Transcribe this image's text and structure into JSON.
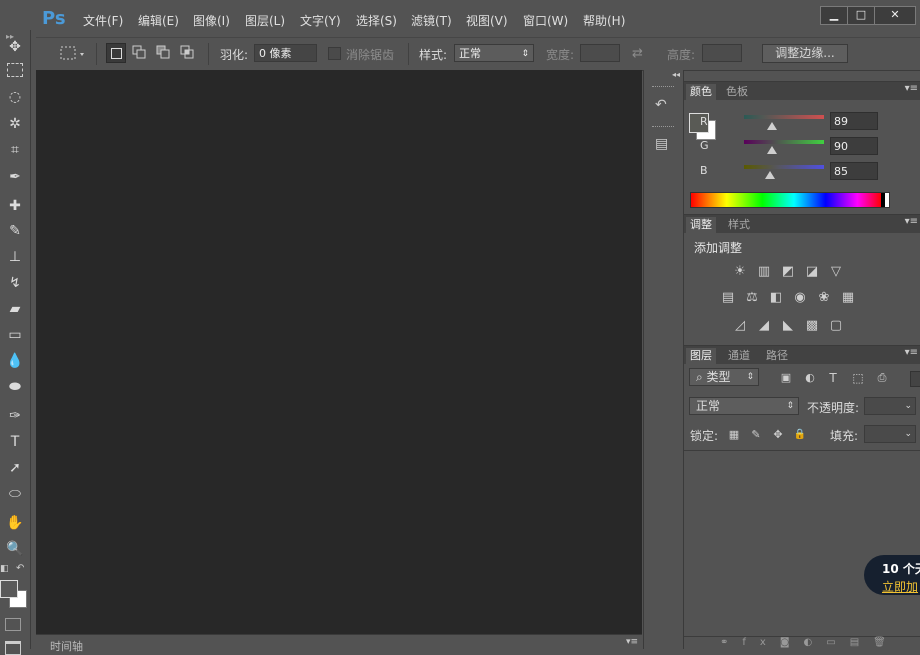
{
  "app": {
    "logo": "Ps"
  },
  "menu": [
    "文件(F)",
    "编辑(E)",
    "图像(I)",
    "图层(L)",
    "文字(Y)",
    "选择(S)",
    "滤镜(T)",
    "视图(V)",
    "窗口(W)",
    "帮助(H)"
  ],
  "window_controls": {
    "minimize": "▁",
    "maximize": "□",
    "close": "✕"
  },
  "options": {
    "feather_label": "羽化:",
    "feather_value": "0 像素",
    "antialias_label": "消除锯齿",
    "style_label": "样式:",
    "style_value": "正常",
    "width_label": "宽度:",
    "height_label": "高度:",
    "refine_edge": "调整边缘..."
  },
  "timeline": {
    "tab": "时间轴"
  },
  "color_panel": {
    "tabs": [
      "颜色",
      "色板"
    ],
    "channels": [
      {
        "label": "R",
        "value": "89",
        "level": 0.35
      },
      {
        "label": "G",
        "value": "90",
        "level": 0.35
      },
      {
        "label": "B",
        "value": "85",
        "level": 0.33
      }
    ],
    "colors": {
      "r_track": "#cc4a4a",
      "g_track": "#3ec43e",
      "b_track": "#4a4ad8"
    }
  },
  "adjust_panel": {
    "tabs": [
      "调整",
      "样式"
    ],
    "heading": "添加调整",
    "icons_row1": [
      "☀",
      "▥",
      "◩",
      "◪",
      "▽"
    ],
    "icons_row2": [
      "▤",
      "⚖",
      "◧",
      "◉",
      "❀",
      "▦"
    ],
    "icons_row3": [
      "◿",
      "◢",
      "◣",
      "▩",
      "▢"
    ]
  },
  "layers_panel": {
    "tabs": [
      "图层",
      "通道",
      "路径"
    ],
    "filter_kind": "⌕ 类型",
    "filter_icons": [
      "▣",
      "◐",
      "T",
      "⬚",
      "⎙"
    ],
    "blend_mode": "正常",
    "opacity_label": "不透明度:",
    "lock_label": "锁定:",
    "lock_icons": [
      "▦",
      "✎",
      "✥",
      "🔒"
    ],
    "fill_label": "填充:"
  },
  "promo": {
    "title": "10 个天",
    "link": "立即加"
  }
}
